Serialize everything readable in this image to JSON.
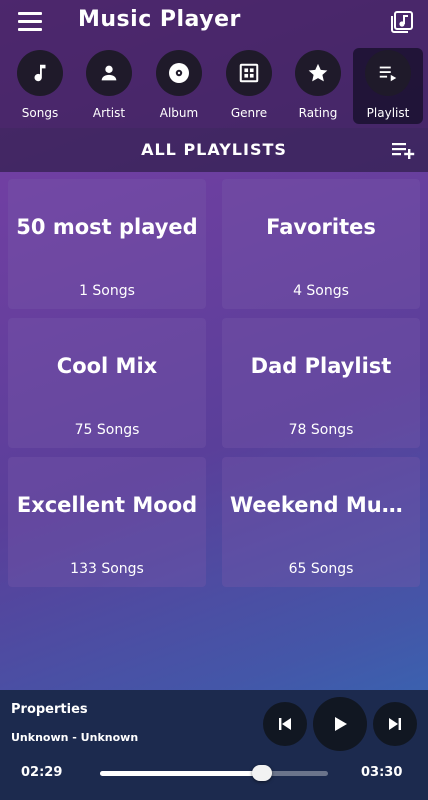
{
  "header": {
    "title": "Music Player",
    "menu_icon": "hamburger-menu-icon",
    "library_icon": "music-library-icon"
  },
  "nav": {
    "items": [
      {
        "label": "Songs",
        "icon": "music-note-icon"
      },
      {
        "label": "Artist",
        "icon": "person-icon"
      },
      {
        "label": "Album",
        "icon": "disc-icon"
      },
      {
        "label": "Genre",
        "icon": "genre-grid-icon"
      },
      {
        "label": "Rating",
        "icon": "star-icon"
      },
      {
        "label": "Playlist",
        "icon": "playlist-icon"
      }
    ],
    "active": "Playlist"
  },
  "playlists": {
    "header": "ALL PLAYLISTS",
    "add_icon": "playlist-add-icon",
    "items": [
      {
        "name": "50 most played",
        "count": "1 Songs"
      },
      {
        "name": "Favorites",
        "count": "4 Songs"
      },
      {
        "name": "Cool Mix",
        "count": "75 Songs"
      },
      {
        "name": "Dad Playlist",
        "count": "78 Songs"
      },
      {
        "name": "Excellent Mood",
        "count": "133 Songs"
      },
      {
        "name": "Weekend Music",
        "count": "65 Songs"
      }
    ]
  },
  "player": {
    "title": "Properties",
    "artist": "Unknown - Unknown",
    "elapsed": "02:29",
    "total": "03:30",
    "progress": 0.71
  },
  "colors": {
    "bar_bg": "#1c2a4e",
    "button_bg": "#111722",
    "nav_circle": "#1f1a2a"
  }
}
